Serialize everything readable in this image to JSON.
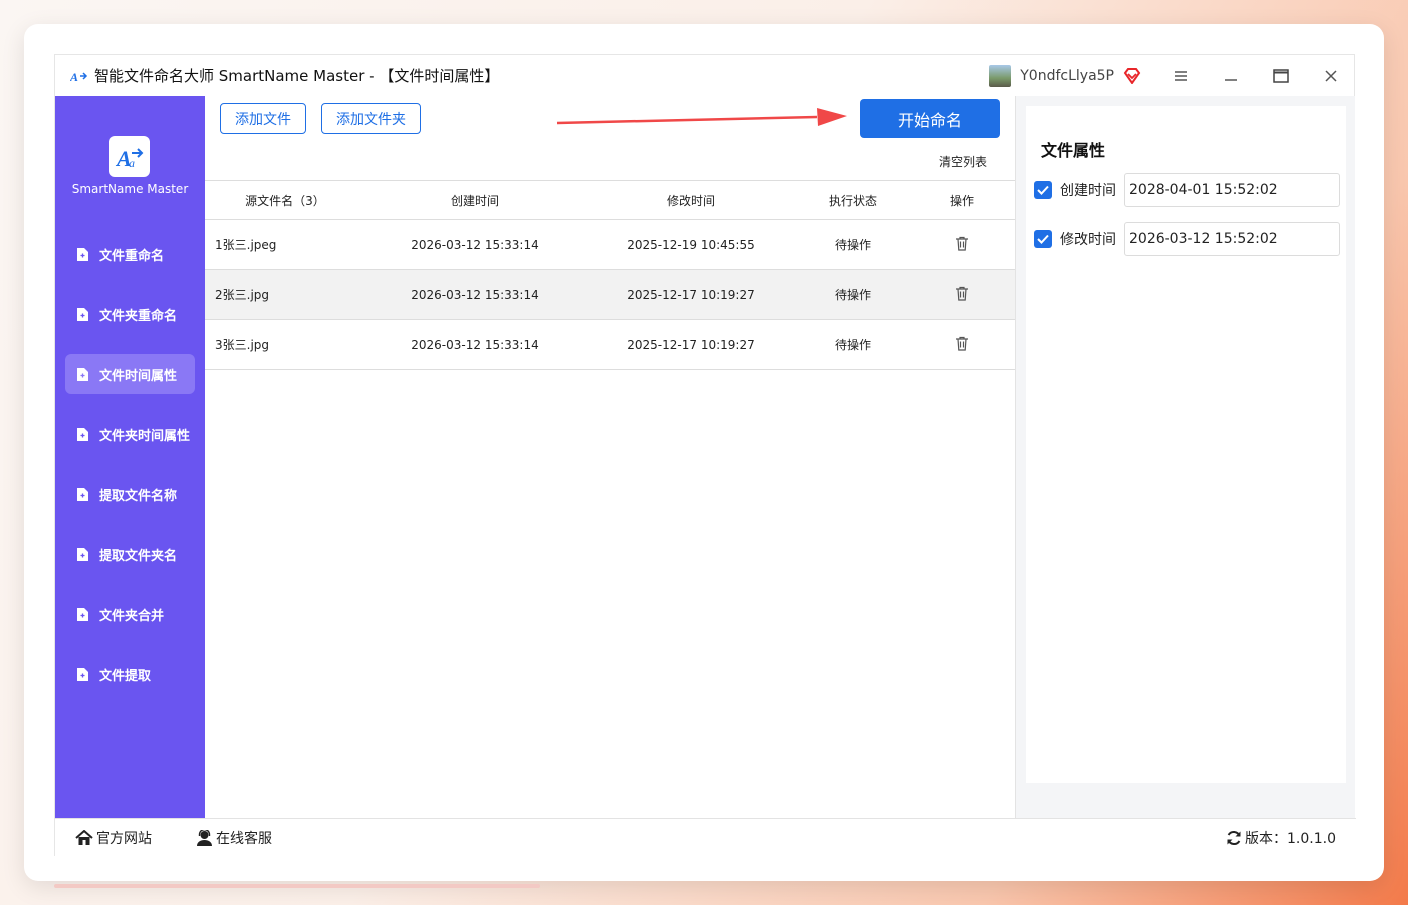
{
  "window": {
    "title": "智能文件命名大师 SmartName Master - 【文件时间属性】",
    "username": "Y0ndfcLlya5P"
  },
  "sidebar": {
    "logo_text": "SmartName Master",
    "items": [
      {
        "label": "文件重命名",
        "active": false
      },
      {
        "label": "文件夹重命名",
        "active": false
      },
      {
        "label": "文件时间属性",
        "active": true
      },
      {
        "label": "文件夹时间属性",
        "active": false
      },
      {
        "label": "提取文件名称",
        "active": false
      },
      {
        "label": "提取文件夹名",
        "active": false
      },
      {
        "label": "文件夹合并",
        "active": false
      },
      {
        "label": "文件提取",
        "active": false
      }
    ]
  },
  "toolbar": {
    "add_file": "添加文件",
    "add_folder": "添加文件夹",
    "start": "开始命名",
    "clear_list": "清空列表"
  },
  "table": {
    "headers": [
      "源文件名（3）",
      "创建时间",
      "修改时间",
      "执行状态",
      "操作"
    ],
    "rows": [
      {
        "name": "1张三.jpeg",
        "created": "2026-03-12 15:33:14",
        "modified": "2025-12-19 10:45:55",
        "status": "待操作"
      },
      {
        "name": "2张三.jpg",
        "created": "2026-03-12 15:33:14",
        "modified": "2025-12-17 10:19:27",
        "status": "待操作"
      },
      {
        "name": "3张三.jpg",
        "created": "2026-03-12 15:33:14",
        "modified": "2025-12-17 10:19:27",
        "status": "待操作"
      }
    ]
  },
  "panel": {
    "title": "文件属性",
    "fields": [
      {
        "label": "创建时间",
        "value": "2028-04-01 15:52:02",
        "checked": true
      },
      {
        "label": "修改时间",
        "value": "2026-03-12 15:52:02",
        "checked": true
      }
    ]
  },
  "statusbar": {
    "website": "官方网站",
    "support": "在线客服",
    "version": "版本：1.0.1.0"
  },
  "colors": {
    "sidebar": "#6a55f0",
    "primary": "#1f6fe5",
    "arrow": "#f04848"
  }
}
